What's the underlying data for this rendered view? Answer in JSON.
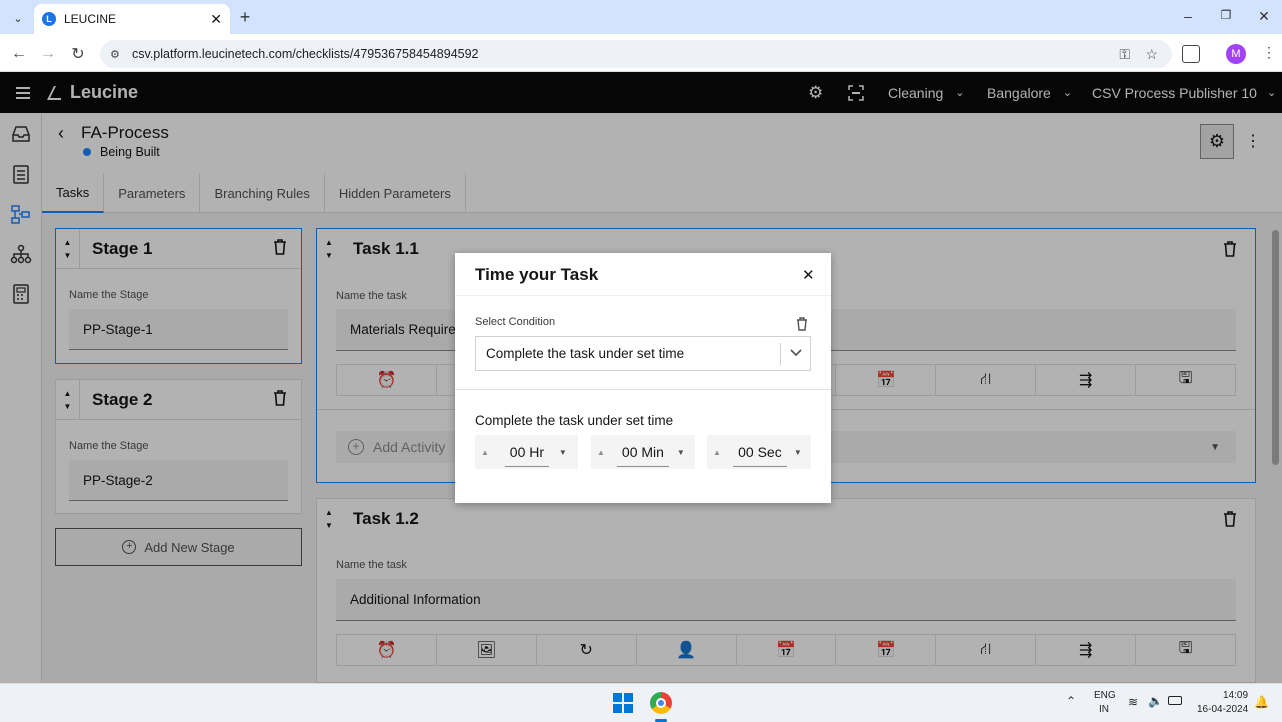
{
  "browser": {
    "tab_title": "LEUCINE",
    "url": "csv.platform.leucinetech.com/checklists/479536758454894592",
    "profile_initial": "M"
  },
  "app": {
    "brand": "Leucine",
    "facility": "Cleaning",
    "location": "Bangalore",
    "user_role": "CSV Process Publisher 10"
  },
  "process": {
    "title": "FA-Process",
    "status": "Being Built",
    "status_color": "#1d84ff"
  },
  "tabs": [
    {
      "label": "Tasks"
    },
    {
      "label": "Parameters"
    },
    {
      "label": "Branching Rules"
    },
    {
      "label": "Hidden Parameters"
    }
  ],
  "stages": [
    {
      "title": "Stage 1",
      "name_label": "Name the Stage",
      "name_value": "PP-Stage-1"
    },
    {
      "title": "Stage 2",
      "name_label": "Name the Stage",
      "name_value": "PP-Stage-2"
    }
  ],
  "add_stage_label": "Add New Stage",
  "tasks": [
    {
      "title": "Task 1.1",
      "name_label": "Name the task",
      "name_value": "Materials Require",
      "add_activity_label": "Add Activity"
    },
    {
      "title": "Task 1.2",
      "name_label": "Name the task",
      "name_value": "Additional Information"
    }
  ],
  "modal": {
    "title": "Time your Task",
    "condition_label": "Select Condition",
    "condition_value": "Complete the task under set time",
    "section_label": "Complete the task under set time",
    "hours": "00 Hr",
    "minutes": "00 Min",
    "seconds": "00 Sec"
  },
  "taskbar": {
    "lang_top": "ENG",
    "lang_bottom": "IN",
    "time": "14:09",
    "date": "16-04-2024"
  }
}
